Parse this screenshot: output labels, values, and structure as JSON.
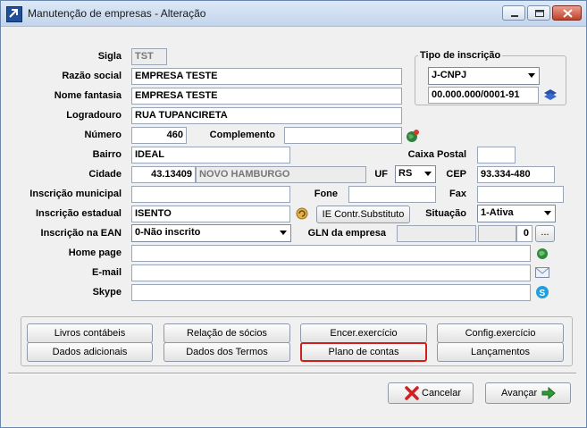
{
  "window": {
    "title": "Manutenção de empresas - Alteração"
  },
  "labels": {
    "sigla": "Sigla",
    "razao_social": "Razão social",
    "nome_fantasia": "Nome fantasia",
    "logradouro": "Logradouro",
    "numero": "Número",
    "complemento": "Complemento",
    "bairro": "Bairro",
    "caixa_postal": "Caixa Postal",
    "cidade": "Cidade",
    "uf": "UF",
    "cep": "CEP",
    "inscricao_municipal": "Inscrição municipal",
    "fone": "Fone",
    "fax": "Fax",
    "inscricao_estadual": "Inscrição estadual",
    "situacao": "Situação",
    "inscricao_ean": "Inscrição na EAN",
    "gln_empresa": "GLN da empresa",
    "home_page": "Home page",
    "email": "E-mail",
    "skype": "Skype",
    "tipo_inscricao": "Tipo de inscrição"
  },
  "fields": {
    "sigla": "TST",
    "razao_social": "EMPRESA TESTE",
    "nome_fantasia": "EMPRESA TESTE",
    "logradouro": "RUA TUPANCIRETA",
    "numero": "460",
    "complemento": "",
    "bairro": "IDEAL",
    "caixa_postal": "",
    "cidade_codigo": "43.13409",
    "cidade_nome": "NOVO HAMBURGO",
    "uf": "RS",
    "cep": "93.334-480",
    "inscricao_municipal": "",
    "fone": "",
    "fax": "",
    "inscricao_estadual": "ISENTO",
    "situacao": "1-Ativa",
    "inscricao_ean": "0-Não inscrito",
    "gln_empresa": "",
    "gln_extra": "",
    "gln_digito": "0",
    "home_page": "",
    "email": "",
    "skype": "",
    "tipo_inscricao": "J-CNPJ",
    "cnpj": "00.000.000/0001-91"
  },
  "buttons": {
    "ie_substituto": "IE Contr.Substituto",
    "gln_more": "...",
    "livros_contabeis": "Livros contábeis",
    "relacao_socios": "Relação de sócios",
    "encer_exercicio": "Encer.exercício",
    "config_exercicio": "Config.exercício",
    "dados_adicionais": "Dados adicionais",
    "dados_termos": "Dados dos Termos",
    "plano_contas": "Plano de contas",
    "lancamentos": "Lançamentos",
    "cancelar": "Cancelar",
    "avancar": "Avançar"
  },
  "icons": {
    "complemento": "world-pin-icon",
    "ie": "refresh-coin-icon",
    "cnpj": "cnpj-lookup-icon",
    "home_page": "globe-icon",
    "email": "envelope-icon",
    "skype": "skype-icon",
    "cancelar": "red-x-icon",
    "avancar": "green-arrow-icon"
  },
  "colors": {
    "highlight_border": "#d01f1f",
    "title_bg": "#c3d5ec"
  }
}
